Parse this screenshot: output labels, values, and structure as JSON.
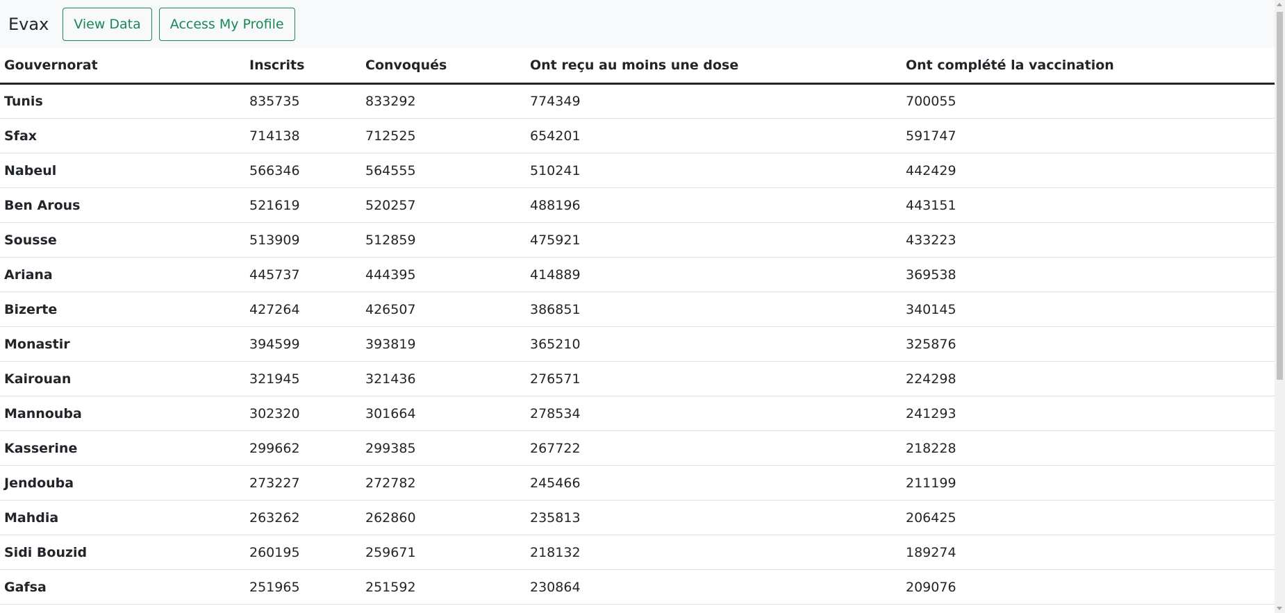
{
  "navbar": {
    "brand": "Evax",
    "buttons": [
      "View Data",
      "Access My Profile"
    ]
  },
  "table": {
    "headers": [
      "Gouvernorat",
      "Inscrits",
      "Convoqués",
      "Ont reçu au moins une dose",
      "Ont complété la vaccination"
    ],
    "rows": [
      [
        "Tunis",
        "835735",
        "833292",
        "774349",
        "700055"
      ],
      [
        "Sfax",
        "714138",
        "712525",
        "654201",
        "591747"
      ],
      [
        "Nabeul",
        "566346",
        "564555",
        "510241",
        "442429"
      ],
      [
        "Ben Arous",
        "521619",
        "520257",
        "488196",
        "443151"
      ],
      [
        "Sousse",
        "513909",
        "512859",
        "475921",
        "433223"
      ],
      [
        "Ariana",
        "445737",
        "444395",
        "414889",
        "369538"
      ],
      [
        "Bizerte",
        "427264",
        "426507",
        "386851",
        "340145"
      ],
      [
        "Monastir",
        "394599",
        "393819",
        "365210",
        "325876"
      ],
      [
        "Kairouan",
        "321945",
        "321436",
        "276571",
        "224298"
      ],
      [
        "Mannouba",
        "302320",
        "301664",
        "278534",
        "241293"
      ],
      [
        "Kasserine",
        "299662",
        "299385",
        "267722",
        "218228"
      ],
      [
        "Jendouba",
        "273227",
        "272782",
        "245466",
        "211199"
      ],
      [
        "Mahdia",
        "263262",
        "262860",
        "235813",
        "206425"
      ],
      [
        "Sidi Bouzid",
        "260195",
        "259671",
        "218132",
        "189274"
      ],
      [
        "Gafsa",
        "251965",
        "251592",
        "230864",
        "209076"
      ]
    ]
  },
  "colors": {
    "navbar_bg": "#f8f9fa",
    "button_accent": "#198754"
  }
}
